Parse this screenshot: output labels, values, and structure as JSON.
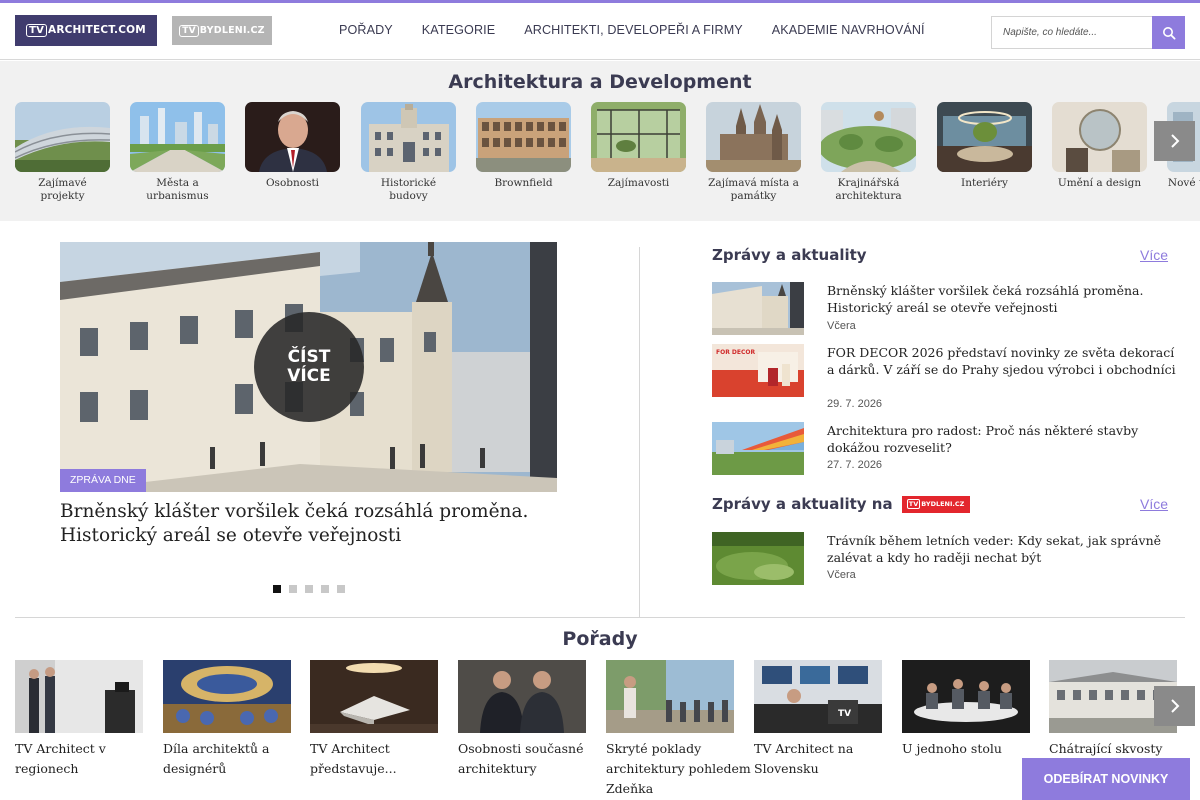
{
  "header": {
    "logo_main": {
      "tv": "TV",
      "rest": "ARCHITECT.COM"
    },
    "logo_secondary": {
      "tv": "TV",
      "rest": "BYDLENI.CZ"
    },
    "nav": [
      "POŘADY",
      "KATEGORIE",
      "ARCHITEKTI, DEVELOPEŘI A FIRMY",
      "AKADEMIE NAVRHOVÁNÍ"
    ],
    "search": {
      "placeholder": "Napište, co hledáte...",
      "value": "",
      "icon": "search-icon"
    }
  },
  "categories": {
    "title": "Architektura a Development",
    "items": [
      {
        "label": "Zajímavé projekty",
        "icon": "modern-building-photo"
      },
      {
        "label": "Města a urbanismus",
        "icon": "city-skyline-photo"
      },
      {
        "label": "Osobnosti",
        "icon": "portrait-photo"
      },
      {
        "label": "Historické budovy",
        "icon": "historic-building-photo"
      },
      {
        "label": "Brownfield",
        "icon": "factory-photo"
      },
      {
        "label": "Zajímavosti",
        "icon": "glass-pavilion-photo"
      },
      {
        "label": "Zajímavá místa a památky",
        "icon": "cathedral-photo"
      },
      {
        "label": "Krajinářská architektura",
        "icon": "park-photo"
      },
      {
        "label": "Interiéry",
        "icon": "interior-photo"
      },
      {
        "label": "Umění a design",
        "icon": "art-photo"
      },
      {
        "label": "Nové technologie",
        "icon": "tech-photo"
      }
    ],
    "next_icon": "chevron-right-icon"
  },
  "hero": {
    "read_more": [
      "ČÍST",
      "VÍCE"
    ],
    "badge": "ZPRÁVA DNE",
    "title": "Brněnský klášter voršilek čeká rozsáhlá proměna. Historický areál se otevře veřejnosti",
    "slides": 5,
    "active_slide": 1
  },
  "news": {
    "title": "Zprávy a aktuality",
    "more": "Více",
    "items": [
      {
        "title": "Brněnský klášter voršilek čeká rozsáhlá proměna. Historický areál se otevře veřejnosti",
        "date": "Včera"
      },
      {
        "title": "FOR DECOR 2026 představí novinky ze světa dekorací a dárků. V září se do Prahy sjedou výrobci i obchodníci",
        "date": "29. 7. 2026"
      },
      {
        "title": "Architektura pro radost: Proč nás některé stavby dokážou rozveselit?",
        "date": "27. 7. 2026"
      }
    ]
  },
  "news_bydleni": {
    "title": "Zprávy a aktuality na",
    "badge": {
      "tv": "TV",
      "rest": "BYDLENI.CZ"
    },
    "more": "Více",
    "items": [
      {
        "title": "Trávník během letních veder: Kdy sekat, jak správně zalévat a kdy ho raději nechat být",
        "date": "Včera"
      }
    ]
  },
  "porady": {
    "title": "Pořady",
    "items": [
      {
        "label": "TV Architect v regionech"
      },
      {
        "label": "Díla architektů a designérů"
      },
      {
        "label": "TV Architect představuje..."
      },
      {
        "label": "Osobnosti současné architektury"
      },
      {
        "label": "Skryté poklady architektury pohledem Zdeňka"
      },
      {
        "label": "TV Architect na Slovensku"
      },
      {
        "label": "U jednoho stolu"
      },
      {
        "label": "Chátrající skvosty"
      }
    ],
    "next_icon": "chevron-right-icon"
  },
  "subscribe": "ODEBÍRAT NOVINKY",
  "colors": {
    "accent": "#8e7bdd",
    "logo_bg": "#403c6e",
    "heading": "#3b3b52",
    "bydleni_red": "#e3262d"
  }
}
